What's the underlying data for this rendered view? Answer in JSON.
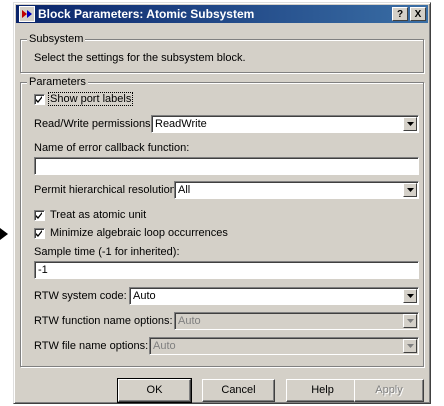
{
  "window": {
    "title": "Block Parameters: Atomic Subsystem",
    "help_label": "?",
    "close_label": "X"
  },
  "subsystem_group": {
    "legend": "Subsystem",
    "description": "Select the settings for the subsystem block."
  },
  "parameters_group": {
    "legend": "Parameters",
    "show_port_labels": {
      "label": "Show port labels",
      "checked": true
    },
    "read_write": {
      "label": "Read/Write permissions:",
      "value": "ReadWrite"
    },
    "error_callback": {
      "label": "Name of error callback function:",
      "value": ""
    },
    "hierarchical_resolution": {
      "label": "Permit hierarchical resolution:",
      "value": "All"
    },
    "atomic_unit": {
      "label": "Treat as atomic unit",
      "checked": true
    },
    "minimize_loops": {
      "label": "Minimize algebraic loop occurrences",
      "checked": true
    },
    "sample_time": {
      "label": "Sample time (-1 for inherited):",
      "value": "-1"
    },
    "rtw_system_code": {
      "label": "RTW system code:",
      "value": "Auto"
    },
    "rtw_function_name": {
      "label": "RTW function name options:",
      "value": "Auto"
    },
    "rtw_file_name": {
      "label": "RTW file name options:",
      "value": "Auto"
    }
  },
  "buttons": {
    "ok": "OK",
    "cancel": "Cancel",
    "help": "Help",
    "apply": "Apply"
  },
  "colors": {
    "face": "#d4d0c8",
    "title_start": "#0a246a",
    "title_end": "#3a6ea5",
    "disabled_text": "#808080"
  }
}
